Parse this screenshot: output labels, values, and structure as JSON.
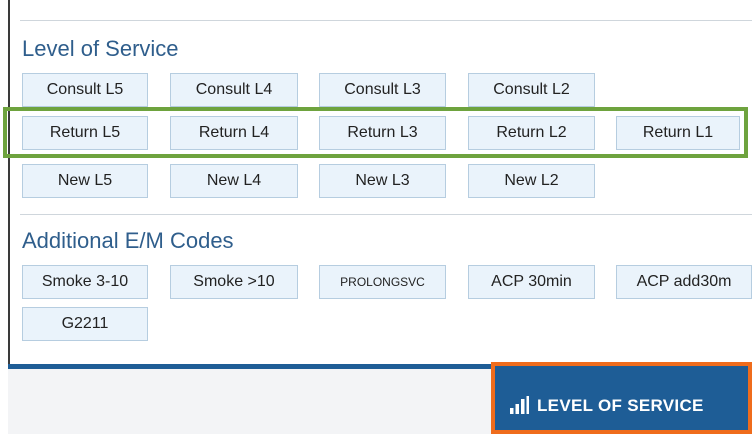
{
  "level_of_service": {
    "title": "Level of Service",
    "consult_row": [
      "Consult L5",
      "Consult L4",
      "Consult L3",
      "Consult L2"
    ],
    "return_row": [
      "Return L5",
      "Return L4",
      "Return L3",
      "Return L2",
      "Return L1"
    ],
    "new_row": [
      "New L5",
      "New L4",
      "New L3",
      "New L2"
    ]
  },
  "additional_codes": {
    "title": "Additional E/M Codes",
    "row1": [
      "Smoke 3-10",
      "Smoke >10",
      "PROLONGSVC",
      "ACP 30min",
      "ACP add30m"
    ],
    "row2": [
      "G2211"
    ]
  },
  "footer": {
    "level_of_service_button": "LEVEL OF SERVICE",
    "icon": "bar-chart-icon"
  },
  "colors": {
    "title_blue": "#2f5e8c",
    "button_fill": "#eaf3fb",
    "highlight_green": "#6ea33e",
    "footer_blue": "#1e5d96",
    "highlight_orange": "#ef6c1c"
  }
}
